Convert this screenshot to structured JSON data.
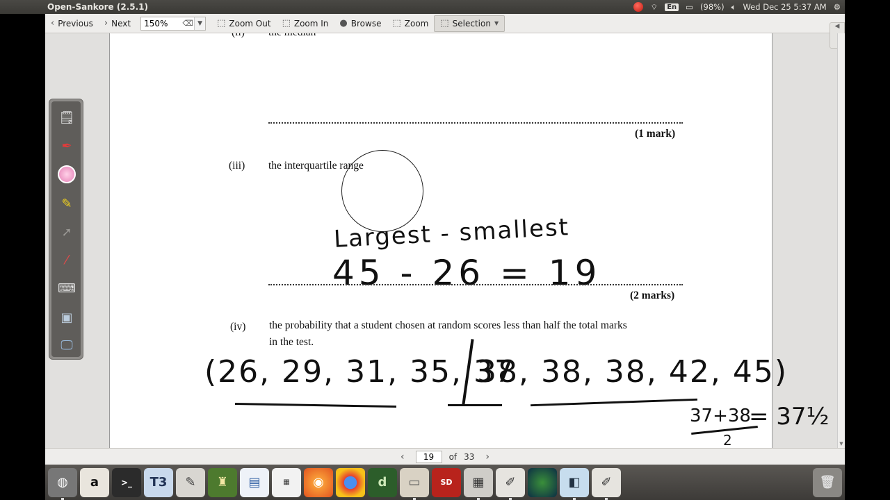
{
  "window": {
    "title": "Open-Sankore (2.5.1)"
  },
  "tray": {
    "lang": "En",
    "battery": "(98%)",
    "datetime": "Wed Dec 25  5:37 AM"
  },
  "toolbar": {
    "previous": "Previous",
    "next": "Next",
    "zoom_value": "150%",
    "zoom_out": "Zoom Out",
    "zoom_in": "Zoom In",
    "browse": "Browse",
    "zoom": "Zoom",
    "selection": "Selection"
  },
  "document": {
    "item_ii_num": "(ii)",
    "item_ii_text": "the median",
    "mark_1": "(1 mark)",
    "item_iii_num": "(iii)",
    "item_iii_text": "the interquartile range",
    "mark_2": "(2 marks)",
    "item_iv_num": "(iv)",
    "item_iv_text_1": "the probability that a student chosen at random scores less than half the total marks",
    "item_iv_text_2": "in the test."
  },
  "handwriting": {
    "line1": "Largest - smallest",
    "line2": "45 - 26 = 19",
    "list_left": "(26, 29, 31, 35, 37",
    "list_right": "38, 38, 38, 42, 45)",
    "fraction_num": "37+38",
    "fraction_den": "2",
    "result": "= 37½"
  },
  "pager": {
    "current": "19",
    "of_label": "of",
    "total": "33"
  },
  "colors": {
    "accent_tool": "#e57fb5",
    "ink": "#111111"
  },
  "palette_tools": [
    "document-icon",
    "pen-icon",
    "eraser-icon",
    "highlighter-icon",
    "pointer-icon",
    "laser-icon",
    "keyboard-icon",
    "screen-capture-icon",
    "display-icon"
  ],
  "dock_apps": [
    "ubuntu-dash-icon",
    "amazon-icon",
    "terminal-icon",
    "t3-icon",
    "text-editor-icon",
    "desk-lamp-icon",
    "writer-icon",
    "libreoffice-icon",
    "firefox-icon",
    "chrome-icon",
    "dreamweaver-icon",
    "file-manager-icon",
    "sd-card-icon",
    "calculator-icon",
    "sankore-icon",
    "globe-icon",
    "document-viewer-icon",
    "sankore-doc-icon",
    "trash-icon"
  ]
}
